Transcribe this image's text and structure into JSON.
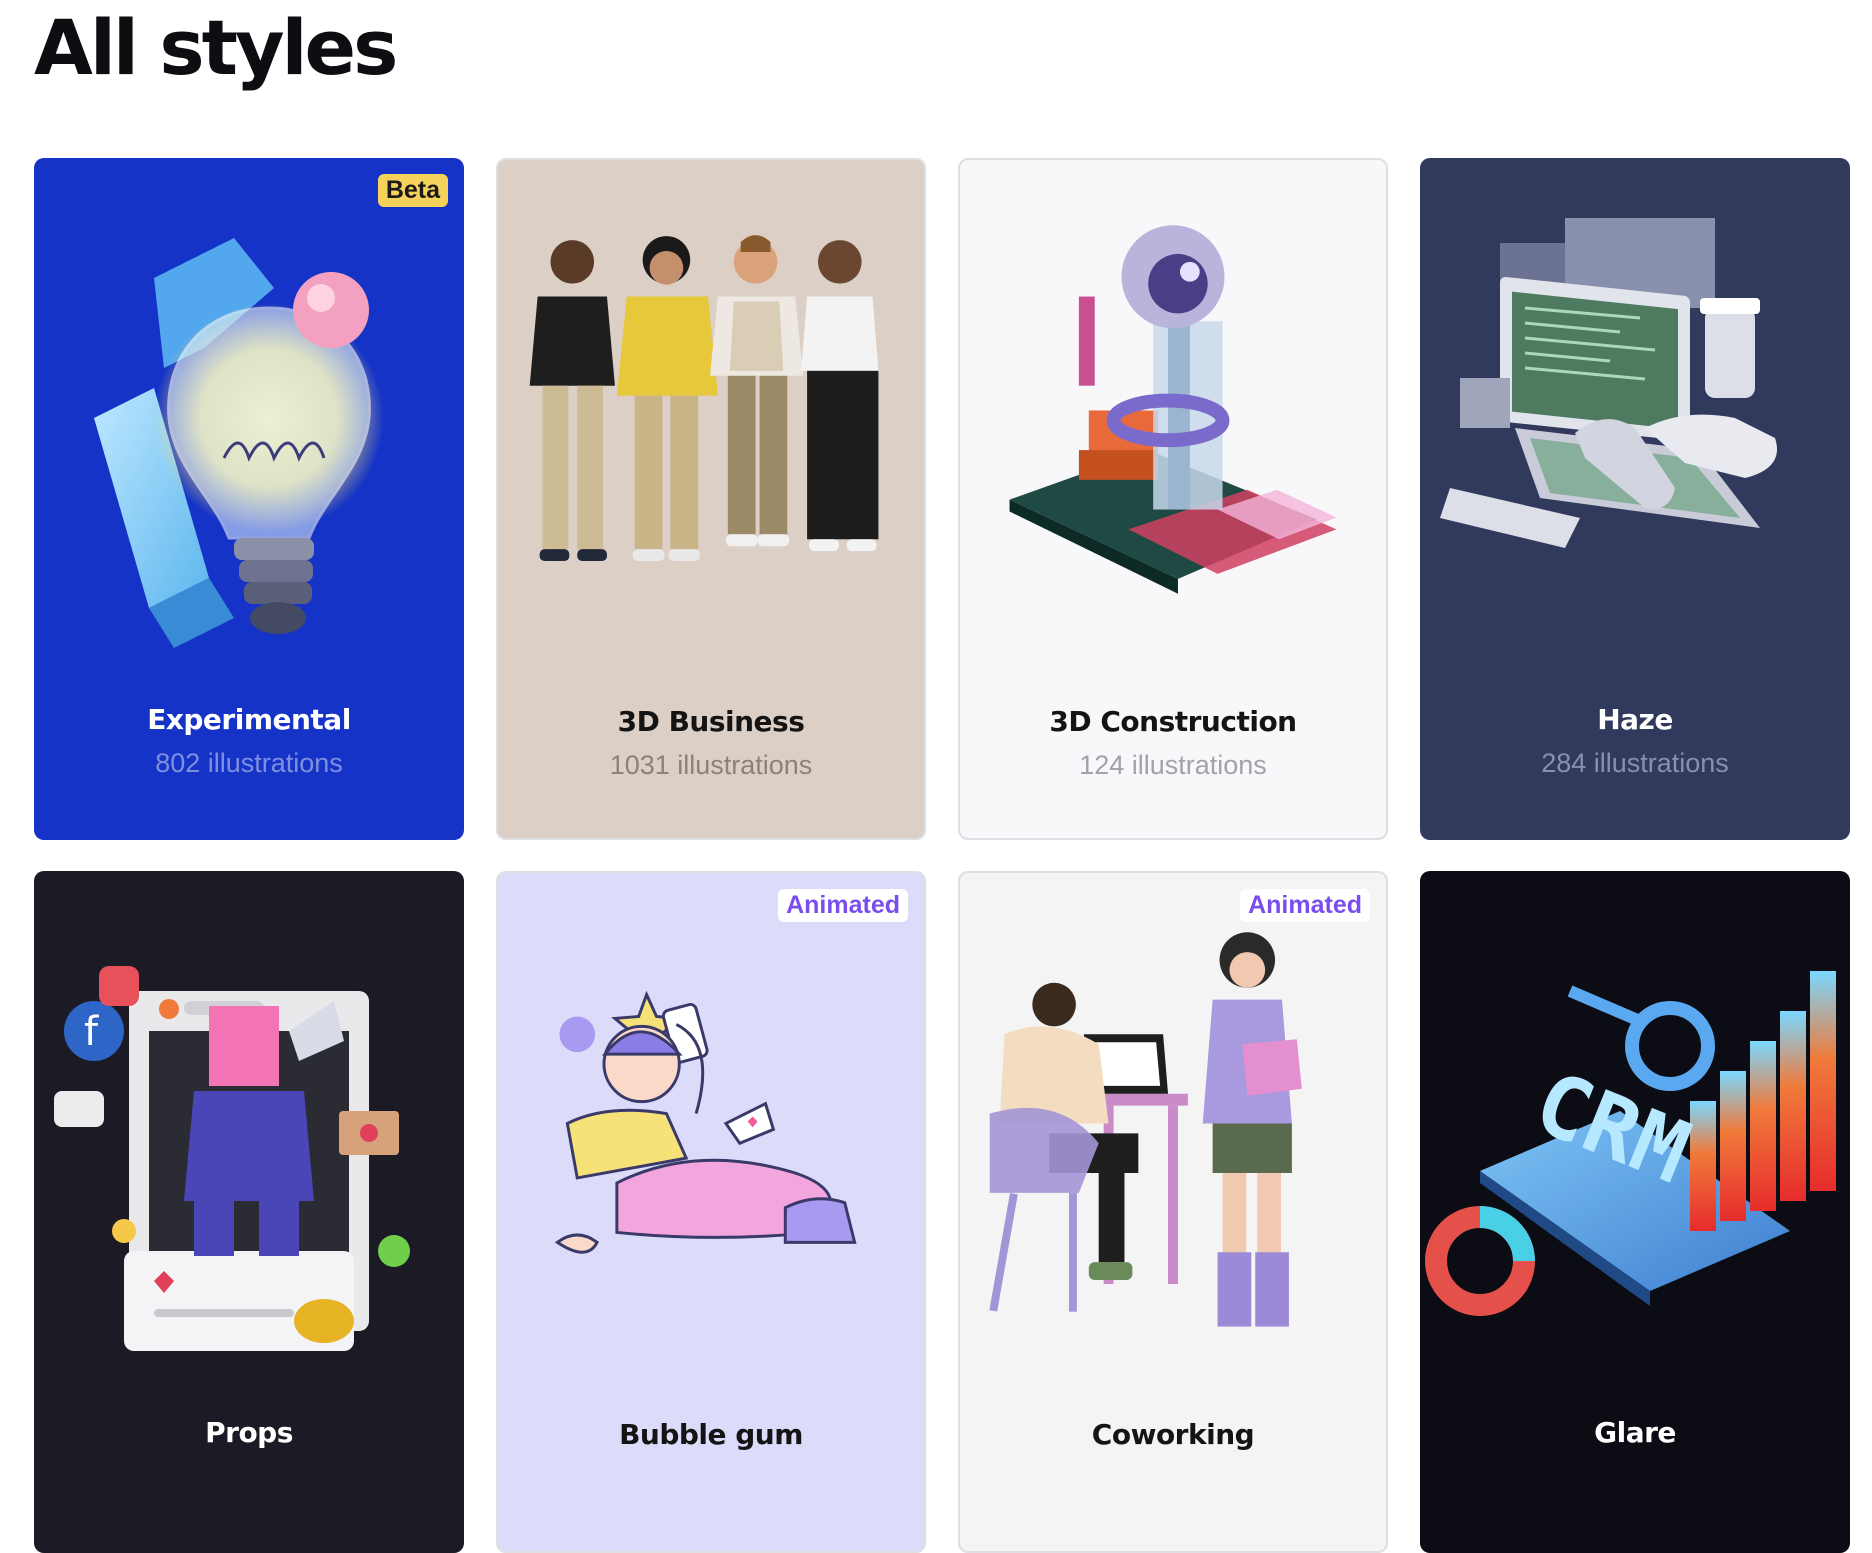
{
  "page": {
    "title": "All styles"
  },
  "cards": [
    {
      "name": "Experimental",
      "count": "802 illustrations",
      "badge": "Beta",
      "bg": "#1533c6",
      "name_color": "#ffffff",
      "count_color": "#7f8fe0"
    },
    {
      "name": "3D Business",
      "count": "1031 illustrations",
      "badge": "",
      "bg": "#dbcfc6",
      "name_color": "#141414",
      "count_color": "#8c827b"
    },
    {
      "name": "3D Construction",
      "count": "124 illustrations",
      "badge": "",
      "bg": "#f8f8fb",
      "name_color": "#141414",
      "count_color": "#a2a2a8"
    },
    {
      "name": "Haze",
      "count": "284 illustrations",
      "badge": "",
      "bg": "#313a5c",
      "name_color": "#ffffff",
      "count_color": "#8790ad"
    },
    {
      "name": "Props",
      "count": "",
      "badge": "",
      "bg": "#1c1b25",
      "name_color": "#ffffff",
      "count_color": "#7a7a85"
    },
    {
      "name": "Bubble gum",
      "count": "",
      "badge": "Animated",
      "bg": "#dcdcfa",
      "name_color": "#141414",
      "count_color": "#8d8da8"
    },
    {
      "name": "Coworking",
      "count": "",
      "badge": "Animated",
      "bg": "#f4f4f5",
      "name_color": "#141414",
      "count_color": "#a2a2a8"
    },
    {
      "name": "Glare",
      "count": "",
      "badge": "",
      "bg": "#0c0c14",
      "name_color": "#ffffff",
      "count_color": "#7a7a85"
    }
  ]
}
